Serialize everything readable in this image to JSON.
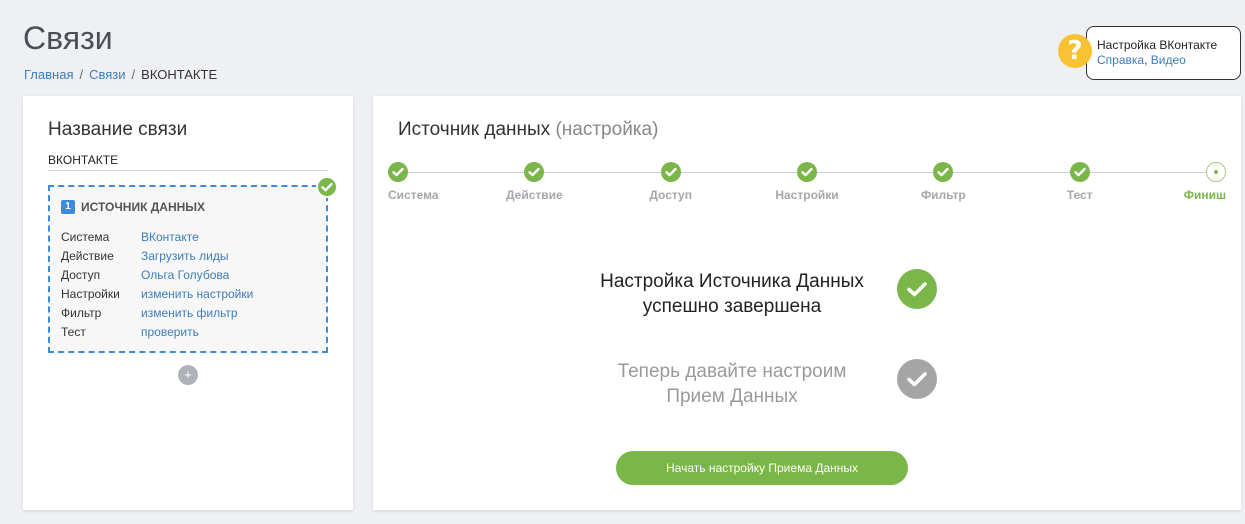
{
  "header": {
    "title": "Связи",
    "breadcrumb": [
      {
        "label": "Главная"
      },
      {
        "label": "Связи"
      },
      {
        "label": "ВКОНТАКТЕ"
      }
    ],
    "separator": "/"
  },
  "help": {
    "icon": "question-icon",
    "title": "Настройка ВКонтакте",
    "link_help": "Справка",
    "comma": ",",
    "link_video": "Видео"
  },
  "left_panel": {
    "title": "Название связи",
    "connection_name": "ВКОНТАКТЕ",
    "source": {
      "number": "1",
      "heading": "ИСТОЧНИК ДАННЫХ",
      "rows": [
        {
          "key": "Система",
          "value": "ВКонтакте"
        },
        {
          "key": "Действие",
          "value": "Загрузить лиды"
        },
        {
          "key": "Доступ",
          "value": "Ольга Голубова"
        },
        {
          "key": "Настройки",
          "value": "изменить настройки"
        },
        {
          "key": "Фильтр",
          "value": "изменить фильтр"
        },
        {
          "key": "Тест",
          "value": "проверить"
        }
      ]
    },
    "add_label": "+"
  },
  "right_panel": {
    "title": "Источник данных",
    "title_sub": "(настройка)",
    "steps": [
      {
        "label": "Система",
        "status": "done"
      },
      {
        "label": "Действие",
        "status": "done"
      },
      {
        "label": "Доступ",
        "status": "done"
      },
      {
        "label": "Настройки",
        "status": "done"
      },
      {
        "label": "Фильтр",
        "status": "done"
      },
      {
        "label": "Тест",
        "status": "done"
      },
      {
        "label": "Финиш",
        "status": "current"
      }
    ],
    "done_line1": "Настройка Источника Данных",
    "done_line2": "успешно завершена",
    "next_line1": "Теперь давайте настроим",
    "next_line2": "Прием Данных",
    "start_button": "Начать настройку Приема Данных"
  },
  "colors": {
    "accent_green": "#7ab648",
    "link_blue": "#3d7dba",
    "help_yellow": "#f8c234",
    "dashed_blue": "#3d8bd9"
  }
}
